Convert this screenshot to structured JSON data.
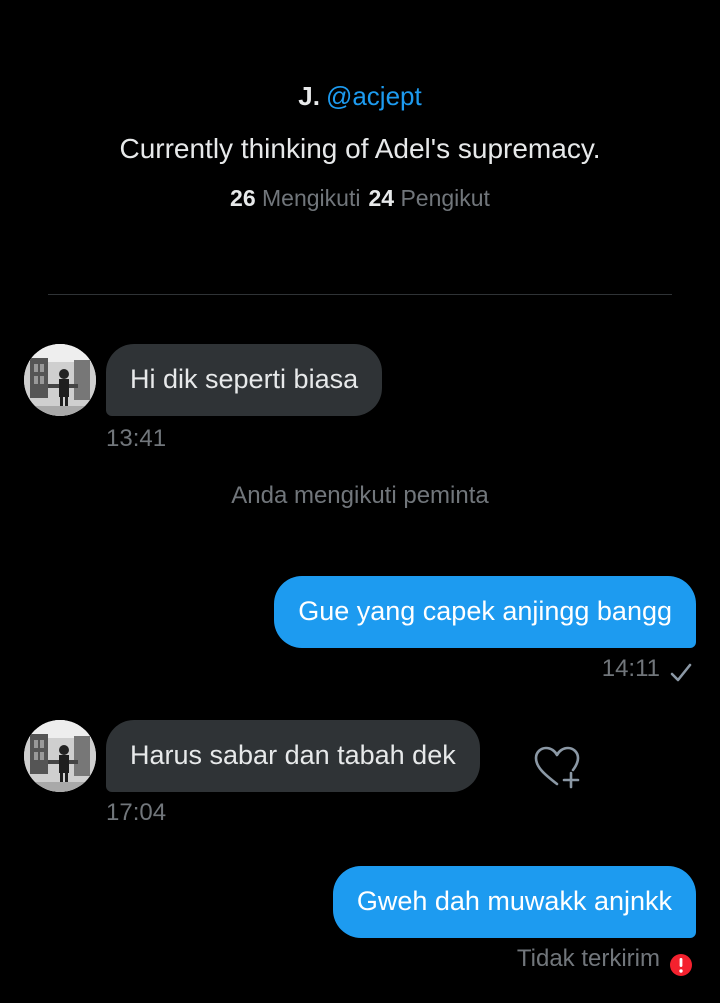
{
  "profile": {
    "name": "J.",
    "handle": "@acjept",
    "bio": "Currently thinking of Adel's supremacy.",
    "following_count": "26",
    "following_label": "Mengikuti",
    "followers_count": "24",
    "followers_label": "Pengikut"
  },
  "messages": [
    {
      "direction": "incoming",
      "text": "Hi dik seperti biasa",
      "time": "13:41"
    },
    {
      "direction": "outgoing",
      "text": "Gue yang capek anjingg bangg",
      "time": "14:11",
      "status_icon": "check-icon"
    },
    {
      "direction": "incoming",
      "text": "Harus sabar dan tabah dek",
      "time": "17:04",
      "reaction_icon": "heart-add-icon"
    },
    {
      "direction": "outgoing",
      "text": "Gweh dah muwakk anjnkk",
      "status": "Tidak terkirim",
      "status_icon": "error-icon"
    }
  ],
  "system_note": "Anda mengikuti peminta",
  "colors": {
    "background": "#000000",
    "accent": "#1d9bf0",
    "incoming_bubble": "#2f3336",
    "muted_text": "#71767b",
    "error": "#f4212e"
  }
}
